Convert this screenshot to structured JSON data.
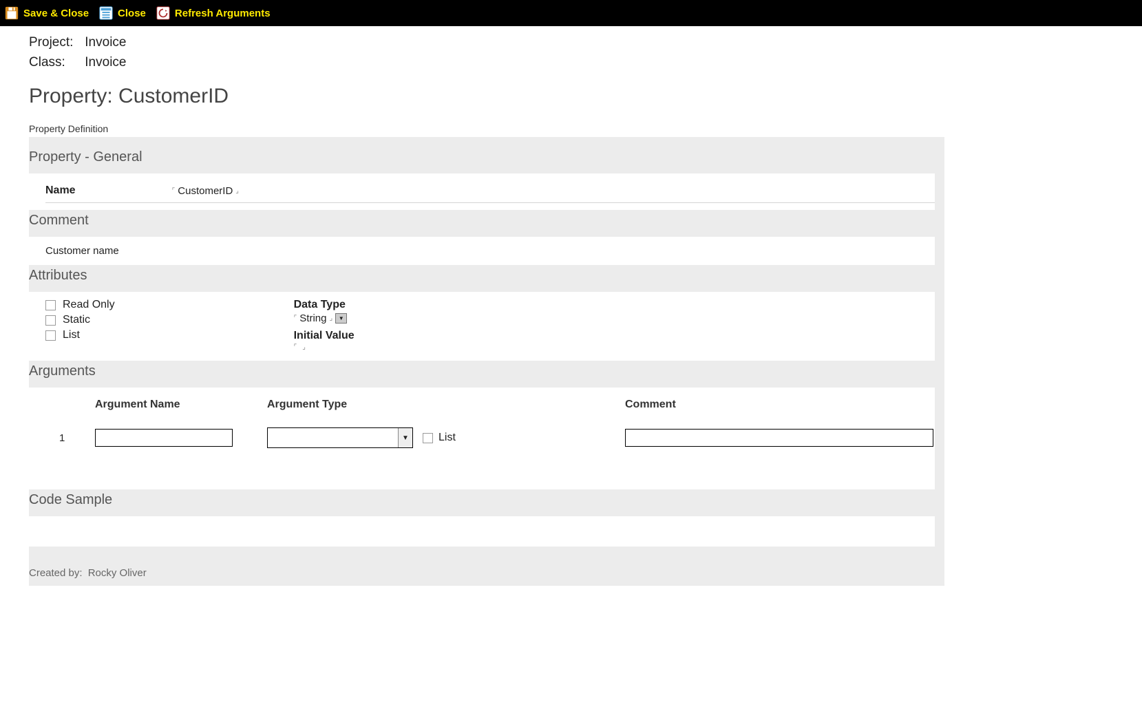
{
  "toolbar": {
    "save_close": "Save & Close",
    "close": "Close",
    "refresh_args": "Refresh Arguments"
  },
  "header": {
    "project_label": "Project:",
    "project_value": "Invoice",
    "class_label": "Class:",
    "class_value": "Invoice",
    "page_title": "Property: CustomerID",
    "definition_caption": "Property Definition"
  },
  "sections": {
    "general_title": "Property - General",
    "name_label": "Name",
    "name_value": "CustomerID",
    "comment_title": "Comment",
    "comment_value": "Customer name",
    "attributes_title": "Attributes",
    "arguments_title": "Arguments",
    "code_sample_title": "Code Sample"
  },
  "attributes": {
    "read_only_label": "Read Only",
    "static_label": "Static",
    "list_label": "List",
    "data_type_label": "Data Type",
    "data_type_value": "String",
    "initial_value_label": "Initial Value",
    "initial_value_value": ""
  },
  "arguments": {
    "col_name": "Argument Name",
    "col_type": "Argument Type",
    "col_comment": "Comment",
    "rows": [
      {
        "index": "1",
        "name": "",
        "type": "",
        "list_label": "List",
        "comment": ""
      }
    ]
  },
  "footer": {
    "created_by_label": "Created by:",
    "created_by_value": "Rocky Oliver"
  }
}
